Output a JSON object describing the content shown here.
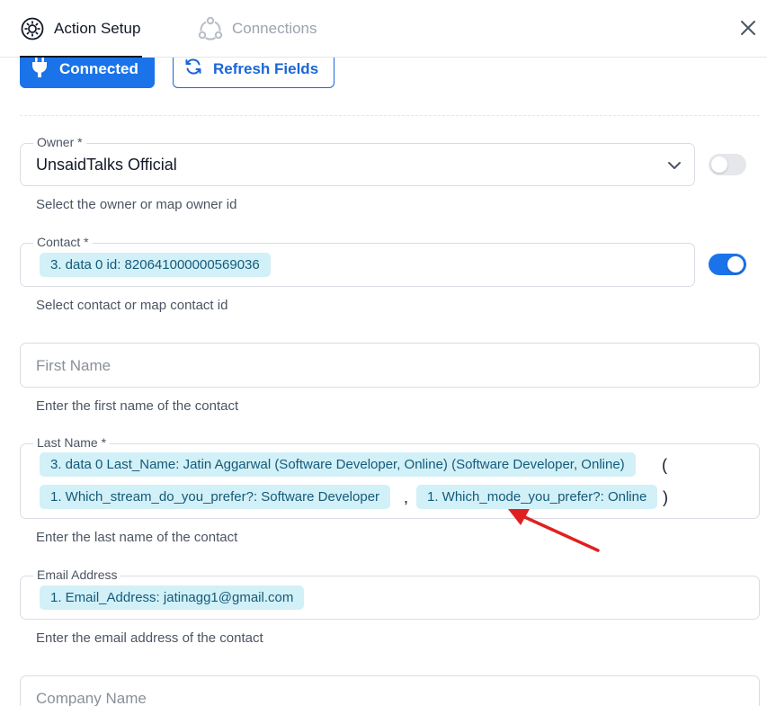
{
  "tabs": {
    "action_setup": "Action Setup",
    "connections": "Connections"
  },
  "buttons": {
    "connected": "Connected",
    "refresh_fields": "Refresh Fields"
  },
  "fields": {
    "owner": {
      "label": "Owner",
      "required": "*",
      "value": "UnsaidTalks Official",
      "help": "Select the owner or map owner id",
      "toggle": "off"
    },
    "contact": {
      "label": "Contact",
      "required": "*",
      "pill": "3. data 0 id: 820641000000569036",
      "help": "Select contact or map contact id",
      "toggle": "on"
    },
    "first_name": {
      "placeholder": "First Name",
      "help": "Enter the first name of the contact"
    },
    "last_name": {
      "label": "Last Name",
      "required": "*",
      "pill1": "3. data 0 Last_Name: Jatin Aggarwal (Software Developer, Online) (Software Developer, Online)",
      "open_paren": "(",
      "pill2": "1. Which_stream_do_you_prefer?: Software Developer",
      "comma": ",",
      "pill3": "1. Which_mode_you_prefer?: Online",
      "close_paren": ")",
      "help": "Enter the last name of the contact"
    },
    "email": {
      "label": "Email Address",
      "pill": "1. Email_Address: jatinagg1@gmail.com",
      "help": "Enter the email address of the contact"
    },
    "company": {
      "placeholder": "Company Name"
    }
  },
  "colors": {
    "accent": "#1a73e8",
    "pill_bg": "#d2f0f7",
    "pill_text": "#145a7a",
    "annotation_arrow": "#e02020"
  }
}
